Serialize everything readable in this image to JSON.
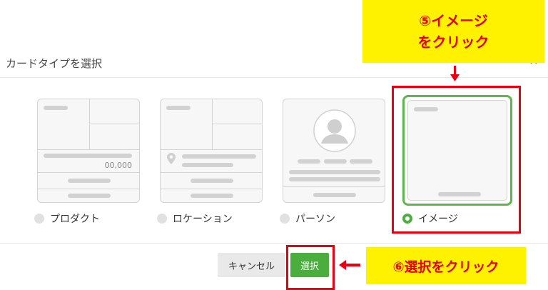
{
  "dialog": {
    "title": "カードタイプを選択",
    "close_icon": "✕"
  },
  "cards": [
    {
      "label": "プロダクト",
      "price": "00,000",
      "selected": false
    },
    {
      "label": "ロケーション",
      "selected": false
    },
    {
      "label": "パーソン",
      "selected": false
    },
    {
      "label": "イメージ",
      "selected": true
    }
  ],
  "footer": {
    "cancel_label": "キャンセル",
    "select_label": "選択"
  },
  "annotations": {
    "top_callout_line1": "⑤イメージ",
    "top_callout_line2": "をクリック",
    "bottom_callout": "⑥選択をクリック"
  },
  "colors": {
    "accent_green": "#4aad3e",
    "annotation_red": "#e60012",
    "annotation_yellow": "#fff200"
  }
}
